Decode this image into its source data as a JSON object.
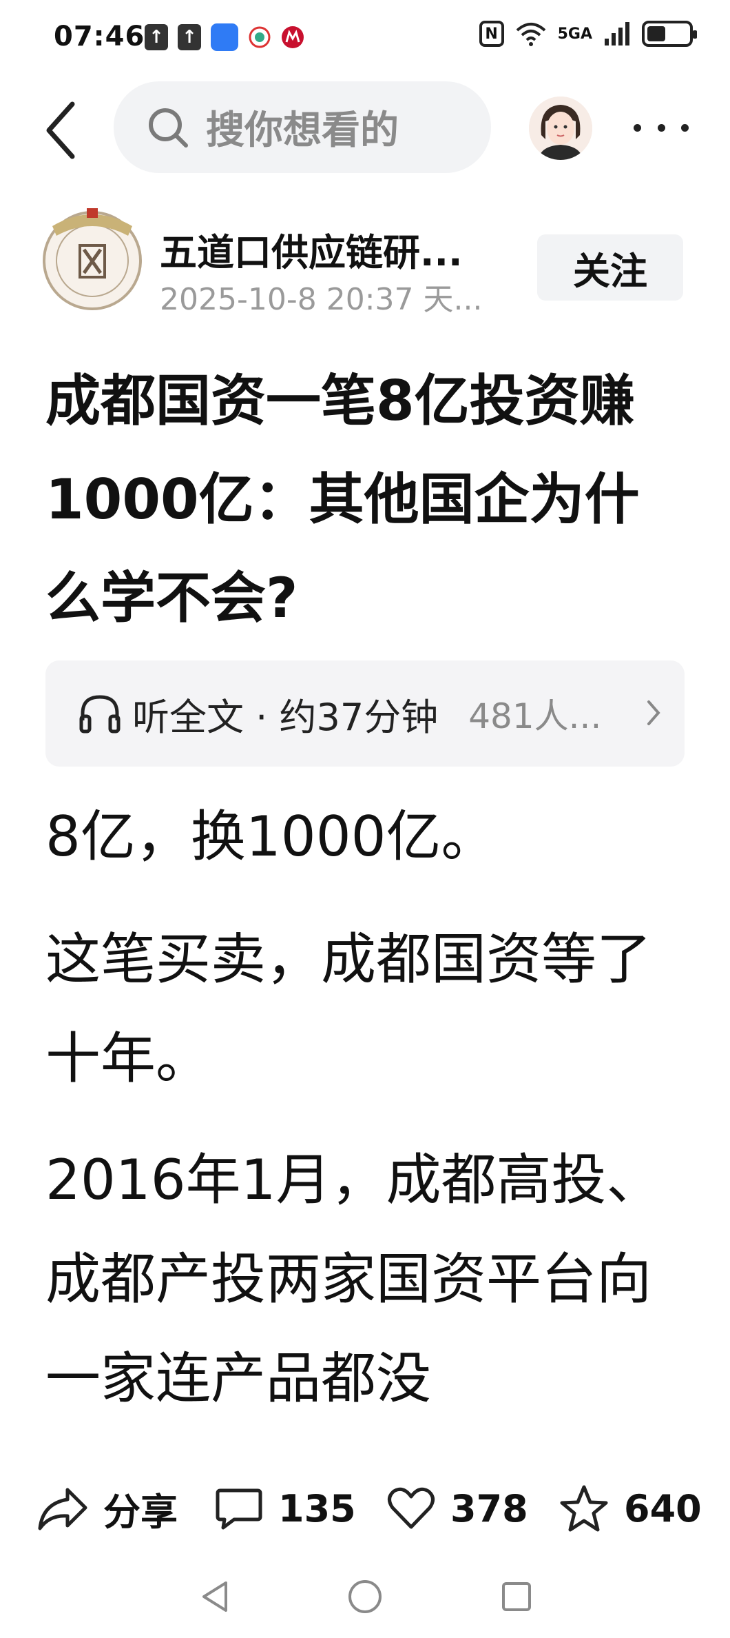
{
  "status": {
    "time": "07:46",
    "signal_label": "5GA",
    "battery_level": 0.45
  },
  "search": {
    "placeholder": "搜你想看的"
  },
  "author": {
    "name": "五道口供应链研...",
    "meta": "2025-10-8  20:37  天...",
    "follow_label": "关注"
  },
  "article": {
    "title": "成都国资一笔8亿投资赚1000亿：其他国企为什么学不会?",
    "paragraphs": [
      "8亿，换1000亿。",
      "这笔买卖，成都国资等了十年。",
      "2016年1月，成都高投、成都产投两家国资平台向一家连产品都没"
    ]
  },
  "listen": {
    "label": "听全文 · 约37分钟",
    "count": "481人..."
  },
  "actions": {
    "share_label": "分享",
    "comments": "135",
    "likes": "378",
    "favorites": "640"
  },
  "icons": {
    "back": "back-icon",
    "search": "search-icon",
    "more": "more-icon",
    "headphones": "headphones-icon",
    "share": "share-icon",
    "comment": "comment-icon",
    "like": "heart-icon",
    "favorite": "star-icon"
  },
  "colors": {
    "background": "#ffffff",
    "text": "#111111",
    "muted": "#9a9a9a",
    "chip": "#f2f3f5"
  }
}
